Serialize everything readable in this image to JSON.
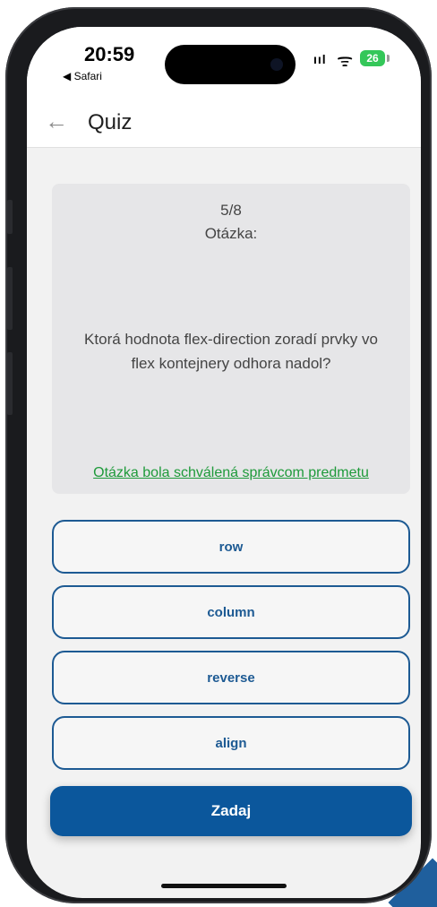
{
  "status_bar": {
    "time": "20:59",
    "back_app": "◀ Safari",
    "signal_glyph": "ııl",
    "wifi_glyph": "ᯤ",
    "battery": "26"
  },
  "header": {
    "back_glyph": "←",
    "title": "Quiz"
  },
  "question": {
    "progress": "5/8",
    "label": "Otázka:",
    "text": "Ktorá hodnota flex-direction zoradí prvky vo flex kontejnery odhora nadol?",
    "approved_text": "Otázka bola schválená správcom predmetu"
  },
  "answers": [
    {
      "label": "row"
    },
    {
      "label": "column"
    },
    {
      "label": "reverse"
    },
    {
      "label": "align"
    }
  ],
  "submit_label": "Zadaj",
  "colors": {
    "accent": "#0b579c",
    "answer_border": "#1d5a93",
    "approved": "#1e9a3a",
    "card_bg": "#e6e6e8",
    "battery": "#34c759"
  },
  "icons": {
    "back": "arrow-left-icon",
    "signal": "cellular-signal-icon",
    "wifi": "wifi-icon",
    "battery": "battery-icon"
  }
}
